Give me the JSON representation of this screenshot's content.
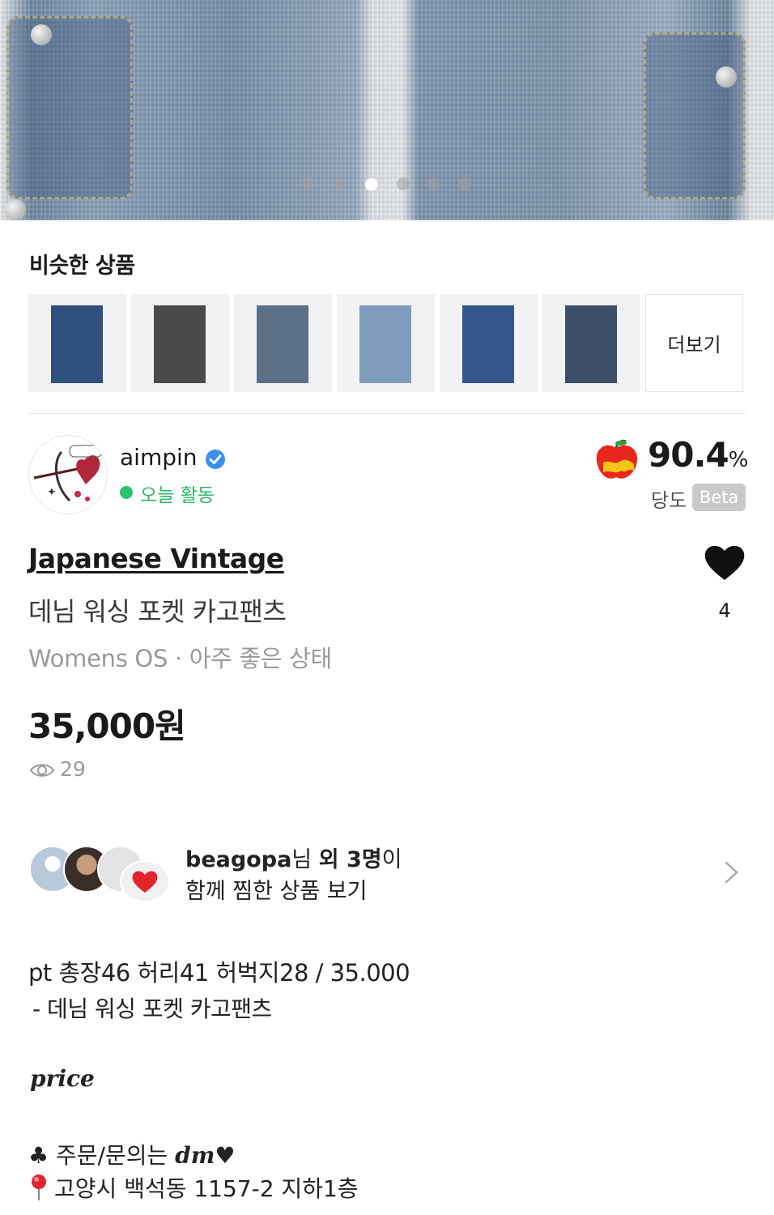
{
  "carousel": {
    "total": 6,
    "active": 3
  },
  "similar": {
    "title": "비슷한 상품",
    "more_label": "더보기",
    "items": [
      {
        "color": "#2f4f7f"
      },
      {
        "color": "#4a4a4a"
      },
      {
        "color": "#5b6f86"
      },
      {
        "color": "#7f9cbc"
      },
      {
        "color": "#34568a"
      },
      {
        "color": "#3d4f68"
      }
    ]
  },
  "seller": {
    "name": "aimpin",
    "activity": "오늘 활동",
    "sweetness_value": "90.4",
    "sweetness_unit": "%",
    "sweetness_label": "당도",
    "beta_badge": "Beta"
  },
  "product": {
    "brand": "Japanese Vintage",
    "name": "데님 워싱 포켓 카고팬츠",
    "meta": "Womens OS · 아주 좋은 상태",
    "price": "35,000원",
    "views": "29",
    "likes": "4"
  },
  "wishlist": {
    "user": "beagopa",
    "suffix_1": "님 ",
    "others": "외 3명",
    "suffix_2": "이",
    "line2": "함께 찜한 상품 보기"
  },
  "description": {
    "line1": "pt 총장46 허리41 허벅지28 / 35.000",
    "line2": "- 데님 워싱 포켓 카고팬츠",
    "price_word": "price",
    "contact_prefix": "♣ 주문/문의는 ",
    "contact_dm": "dm",
    "contact_heart": "♥",
    "address": "고양시 백석동 1157-2 지하1층"
  },
  "colors": {
    "active_green": "#2cc36b",
    "heart": "#111111",
    "apple_red": "#e8261b",
    "apple_yellow": "#f7c316"
  }
}
